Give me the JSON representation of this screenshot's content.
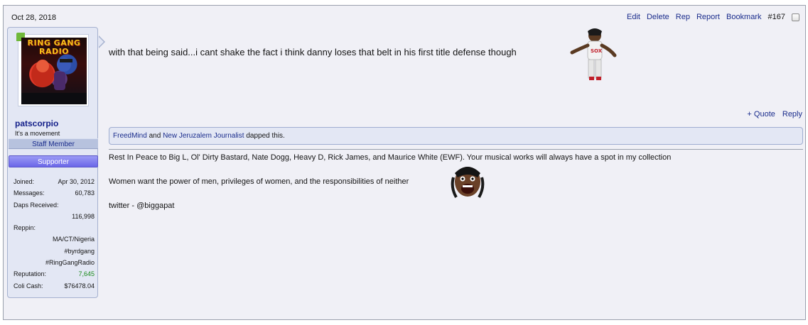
{
  "post": {
    "date": "Oct 28, 2018",
    "links": {
      "edit": "Edit",
      "delete": "Delete",
      "rep": "Rep",
      "report": "Report",
      "bookmark": "Bookmark",
      "number": "#167"
    },
    "message": "with that being said...i cant shake the fact i think danny loses that belt in his first title defense though",
    "actions": {
      "quote": "+ Quote",
      "reply": "Reply"
    },
    "likes": {
      "user1": "FreedMind",
      "and": "and",
      "user2": "New Jeruzalem Journalist",
      "suffix": "dapped this."
    },
    "signature": {
      "line1": "Rest In Peace to Big L, Ol' Dirty Bastard, Nate Dogg, Heavy D, Rick James, and Maurice White (EWF). Your musical works will always have a spot in my collection",
      "line2": "Women want the power of men, privileges of women, and the responsibilities of neither",
      "line3": "twitter - @biggapat"
    }
  },
  "user": {
    "avatar_logo_line1": "RING GANG",
    "avatar_logo_line2": "RADIO",
    "username": "patscorpio",
    "title": "It's a movement",
    "banner_staff": "Staff Member",
    "banner_supporter": "Supporter",
    "stats": {
      "joined_label": "Joined:",
      "joined": "Apr 30, 2012",
      "messages_label": "Messages:",
      "messages": "60,783",
      "daps_label": "Daps Received:",
      "daps": "116,998",
      "reppin_label": "Reppin:",
      "reppin1": "MA/CT/Nigeria",
      "reppin2": "#byrdgang",
      "reppin3": "#RingGangRadio",
      "reputation_label": "Reputation:",
      "reputation": "7,645",
      "cash_label": "Coli Cash:",
      "cash": "$76478.04"
    }
  },
  "colors": {
    "link": "#1a2c8c",
    "reputation": "#1a8a1a",
    "supporter": "#6a66e8",
    "panel": "#e3e7f4"
  }
}
